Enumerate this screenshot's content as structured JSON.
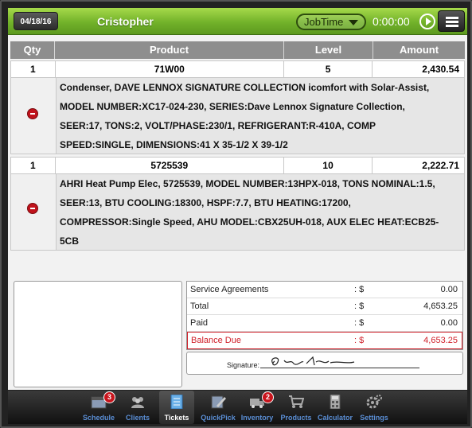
{
  "header": {
    "date": "04/18/16",
    "technician": "Cristopher",
    "jobtime_label": "JobTime",
    "timer": "0:00:00"
  },
  "table": {
    "headers": {
      "qty": "Qty",
      "product": "Product",
      "level": "Level",
      "amount": "Amount"
    },
    "items": [
      {
        "qty": "1",
        "product": "71W00",
        "level": "5",
        "amount": "2,430.54",
        "description": [
          "Condenser, DAVE LENNOX SIGNATURE COLLECTION icomfort with Solar-Assist,",
          "MODEL NUMBER:XC17-024-230, SERIES:Dave Lennox Signature Collection,",
          "SEER:17, TONS:2, VOLT/PHASE:230/1, REFRIGERANT:R-410A, COMP",
          "SPEED:SINGLE, DIMENSIONS:41 X 35-1/2 X 39-1/2"
        ]
      },
      {
        "qty": "1",
        "product": "5725539",
        "level": "10",
        "amount": "2,222.71",
        "description": [
          "AHRI Heat Pump Elec, 5725539, MODEL NUMBER:13HPX-018, TONS NOMINAL:1.5,",
          "SEER:13, BTU COOLING:18300, HSPF:7.7, BTU HEATING:17200,",
          "COMPRESSOR:Single Speed, AHU MODEL:CBX25UH-018, AUX ELEC HEAT:ECB25-",
          "5CB"
        ]
      }
    ]
  },
  "totals": {
    "separator": ": $",
    "rows": [
      {
        "label": "Service Agreements",
        "value": "0.00"
      },
      {
        "label": "Total",
        "value": "4,653.25"
      },
      {
        "label": "Paid",
        "value": "0.00"
      },
      {
        "label": "Balance Due",
        "value": "4,653.25"
      }
    ]
  },
  "signature": {
    "label": "Signature:"
  },
  "tabs": [
    {
      "label": "Schedule",
      "icon": "calendar-icon",
      "badge": "3"
    },
    {
      "label": "Clients",
      "icon": "people-icon"
    },
    {
      "label": "Tickets",
      "icon": "ticket-icon",
      "active": true
    },
    {
      "label": "QuickPick",
      "icon": "pencil-icon"
    },
    {
      "label": "Inventory",
      "icon": "truck-icon",
      "badge": "2"
    },
    {
      "label": "Products",
      "icon": "cart-icon"
    },
    {
      "label": "Calculator",
      "icon": "calculator-icon"
    },
    {
      "label": "Settings",
      "icon": "gear-icon"
    }
  ],
  "colors": {
    "accent_green": "#72b22a",
    "tab_blue": "#5b8fd6",
    "due_red": "#d0202a",
    "badge_red": "#c8141c"
  }
}
